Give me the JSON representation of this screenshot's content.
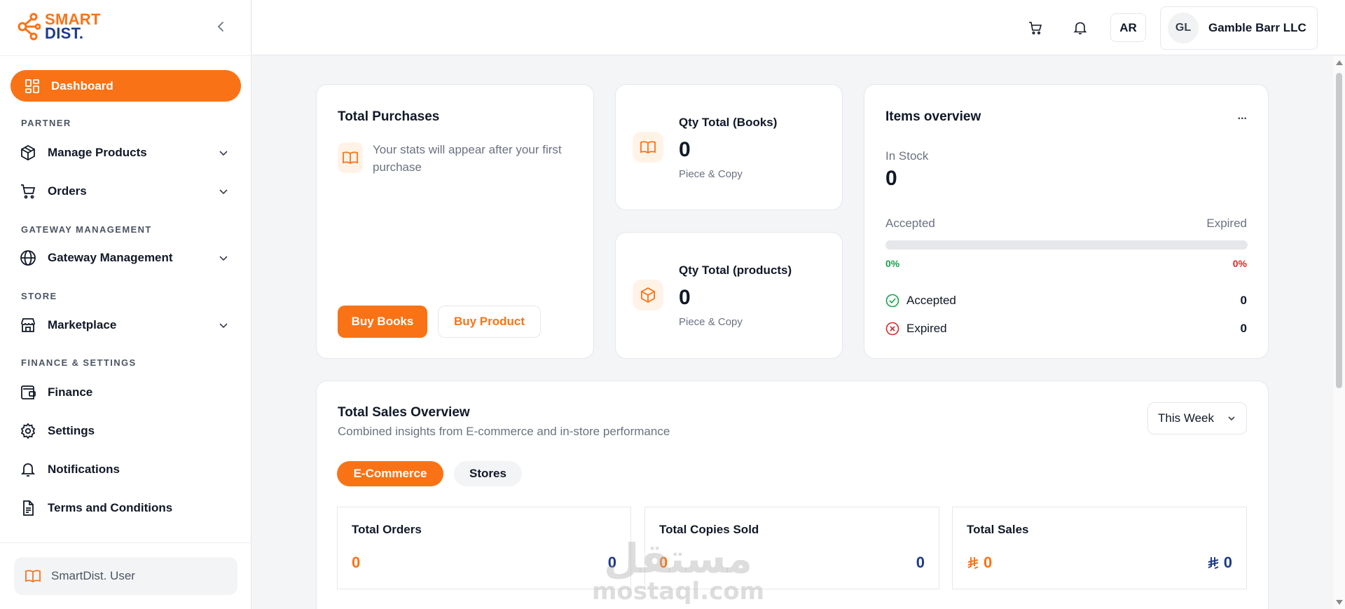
{
  "brand": {
    "line1": "SMART",
    "line2": "DIST."
  },
  "sidebar": {
    "active_item": "Dashboard",
    "sections": {
      "partner": "PARTNER",
      "gateway": "GATEWAY MANAGEMENT",
      "store": "STORE",
      "finance": "FINANCE & SETTINGS"
    },
    "items": {
      "manage_products": "Manage Products",
      "orders": "Orders",
      "gateway_management": "Gateway Management",
      "marketplace": "Marketplace",
      "finance": "Finance",
      "settings": "Settings",
      "notifications": "Notifications",
      "terms": "Terms and Conditions"
    },
    "user": "SmartDist. User"
  },
  "header": {
    "language": "AR",
    "avatar_initials": "GL",
    "account_name": "Gamble Barr LLC"
  },
  "total_purchases": {
    "title": "Total Purchases",
    "message": "Your stats will appear after your first purchase",
    "buy_books": "Buy Books",
    "buy_product": "Buy Product"
  },
  "qty_books": {
    "title": "Qty Total (Books)",
    "value": "0",
    "unit": "Piece & Copy"
  },
  "qty_products": {
    "title": "Qty Total (products)",
    "value": "0",
    "unit": "Piece & Copy"
  },
  "items_overview": {
    "title": "Items overview",
    "menu": "...",
    "in_stock_label": "In Stock",
    "in_stock_value": "0",
    "accepted_label": "Accepted",
    "expired_label": "Expired",
    "accepted_pct": "0%",
    "expired_pct": "0%",
    "accepted_fraction": 0,
    "rows": {
      "accepted": {
        "label": "Accepted",
        "value": "0"
      },
      "expired": {
        "label": "Expired",
        "value": "0"
      }
    }
  },
  "sales_overview": {
    "title": "Total Sales Overview",
    "subtitle": "Combined insights from E-commerce and in-store performance",
    "period": "This Week",
    "tabs": {
      "ecommerce": "E-Commerce",
      "stores": "Stores"
    },
    "stats": {
      "orders": {
        "label": "Total Orders",
        "left": "0",
        "right": "0"
      },
      "copies": {
        "label": "Total Copies Sold",
        "left": "0",
        "right": "0"
      },
      "sales": {
        "label": "Total Sales",
        "left": "0",
        "right": "0"
      }
    }
  },
  "watermark": {
    "arabic": "مستقل",
    "latin": "mostaql.com"
  },
  "colors": {
    "accent": "#f97316",
    "navy": "#1e3a8a",
    "success": "#16a34a",
    "danger": "#dc2626"
  }
}
